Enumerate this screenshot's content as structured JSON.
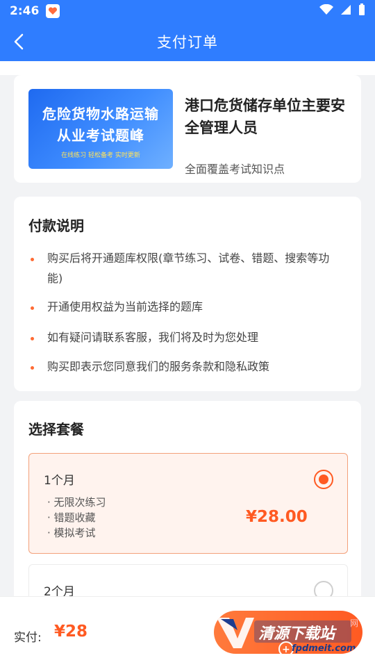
{
  "status_bar": {
    "time": "2:46"
  },
  "app_bar": {
    "title": "支付订单"
  },
  "product": {
    "cover_line1": "危险货物水路运输",
    "cover_line2": "从业考试题峰",
    "cover_line3": "在线练习 轻松备考 实时更新",
    "title": "港口危货储存单位主要安全管理人员",
    "subtitle": "全面覆盖考试知识点"
  },
  "payment_notes": {
    "heading": "付款说明",
    "items": [
      "购买后将开通题库权限(章节练习、试卷、错题、搜索等功能)",
      "开通使用权益为当前选择的题库",
      "如有疑问请联系客服，我们将及时为您处理",
      "购买即表示您同意我们的服务条款和隐私政策"
    ]
  },
  "plans": {
    "heading": "选择套餐",
    "items": [
      {
        "name": "1个月",
        "features": [
          "· 无限次练习",
          "· 错题收藏",
          "· 模拟考试"
        ],
        "price": "¥28.00",
        "selected": true
      },
      {
        "name": "2个月",
        "selected": false
      }
    ]
  },
  "footer": {
    "pay_label": "实付:",
    "pay_amount": "¥28",
    "logo_text": "清源下载站",
    "watermark_text": "fpdmeit.com",
    "watermark_suffix": "网"
  },
  "colors": {
    "primary": "#2f7dff",
    "accent": "#ff5a22",
    "selected_bg": "#fff3ee"
  }
}
